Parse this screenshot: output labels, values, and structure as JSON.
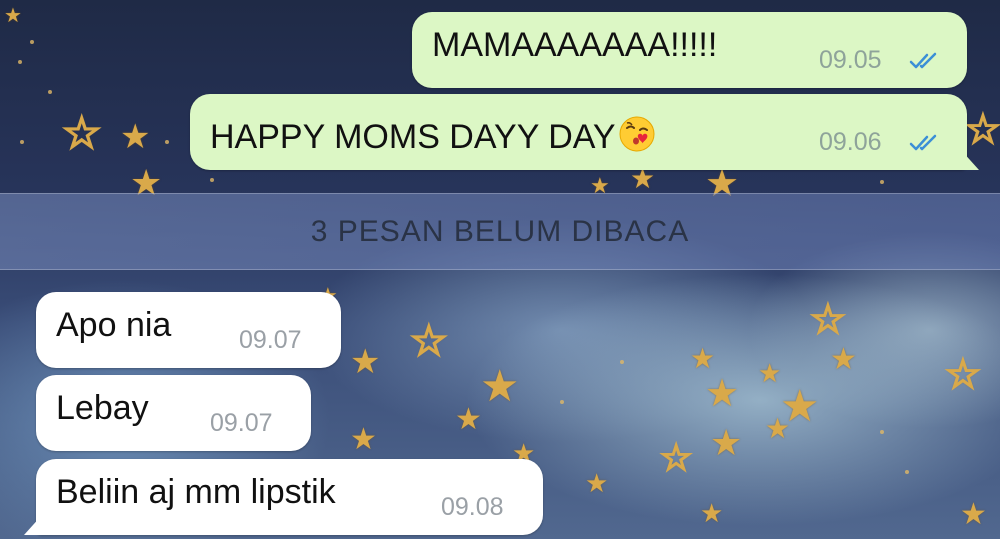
{
  "chat": {
    "outgoing": [
      {
        "text": "MAMAAAAAAA!!!!!",
        "time": "09.05",
        "status": "read"
      },
      {
        "text": "HAPPY MOMS DAYY DAY",
        "emoji": "kissing-heart-emoji",
        "time": "09.06",
        "status": "read"
      }
    ],
    "unread_banner": "3 PESAN BELUM DIBACA",
    "incoming": [
      {
        "text": "Apo nia",
        "time": "09.07"
      },
      {
        "text": "Lebay",
        "time": "09.07"
      },
      {
        "text": "Beliin aj mm lipstik",
        "time": "09.08"
      }
    ]
  },
  "colors": {
    "outgoing_bubble": "#dcf7c5",
    "incoming_bubble": "#ffffff",
    "read_ticks": "#3b8fd6",
    "star_gold": "#d9a94a"
  }
}
